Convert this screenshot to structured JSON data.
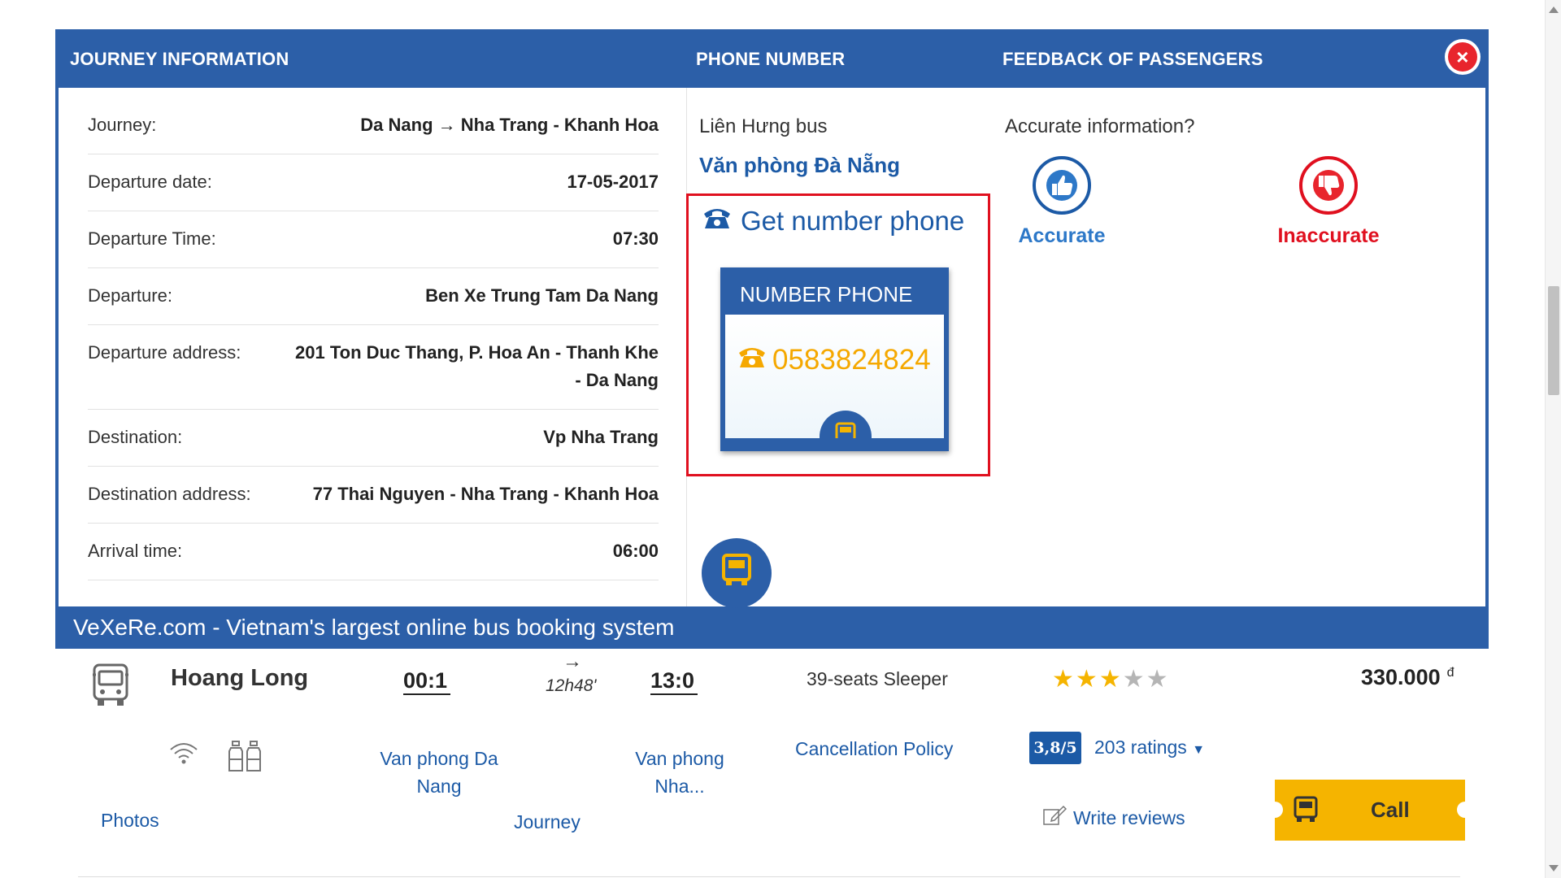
{
  "modal": {
    "headers": {
      "journey_info": "JOURNEY INFORMATION",
      "phone_number": "PHONE NUMBER",
      "feedback": "FEEDBACK OF PASSENGERS"
    },
    "close_icon": "close-icon",
    "journey_rows": [
      {
        "label": "Journey:",
        "value": "Da Nang → Nha Trang - Khanh Hoa"
      },
      {
        "label": "Departure date:",
        "value": "17-05-2017"
      },
      {
        "label": "Departure Time:",
        "value": "07:30"
      },
      {
        "label": "Departure:",
        "value": "Ben Xe Trung Tam Da Nang"
      },
      {
        "label": "Departure address:",
        "value": "201 Ton Duc Thang, P. Hoa An - Thanh Khe - Da Nang"
      },
      {
        "label": "Destination:",
        "value": "Vp Nha Trang"
      },
      {
        "label": "Destination address:",
        "value": "77 Thai Nguyen - Nha Trang - Khanh Hoa"
      },
      {
        "label": "Arrival time:",
        "value": "06:00"
      }
    ],
    "phone": {
      "operator": "Liên Hưng bus",
      "office": "Văn phòng Đà Nẵng",
      "get_number": "Get number phone",
      "card_title": "NUMBER PHONE",
      "number": "0583824824"
    },
    "feedback": {
      "question": "Accurate information?",
      "accurate": "Accurate",
      "inaccurate": "Inaccurate"
    },
    "footer": "VeXeRe.com - Vietnam's largest online bus booking system"
  },
  "listing": {
    "company": "Hoang Long",
    "depart_time": "00:1",
    "arrive_time": "13:0",
    "duration": "12h48'",
    "arrow": "→",
    "seat_type": "39-seats Sleeper",
    "stars": 3,
    "price": "330.000",
    "currency": "đ",
    "from_office": "Van phong Da Nang",
    "to_office": "Van phong Nha...",
    "cancellation": "Cancellation Policy",
    "rating_score": "3,8/5",
    "ratings": "203 ratings",
    "photos": "Photos",
    "journey": "Journey",
    "write_reviews": "Write reviews",
    "call": "Call"
  },
  "colors": {
    "brand_blue": "#2c5fa8",
    "link_blue": "#1c5aa6",
    "accent_yellow": "#f5b400",
    "alert_red": "#e0101f"
  }
}
